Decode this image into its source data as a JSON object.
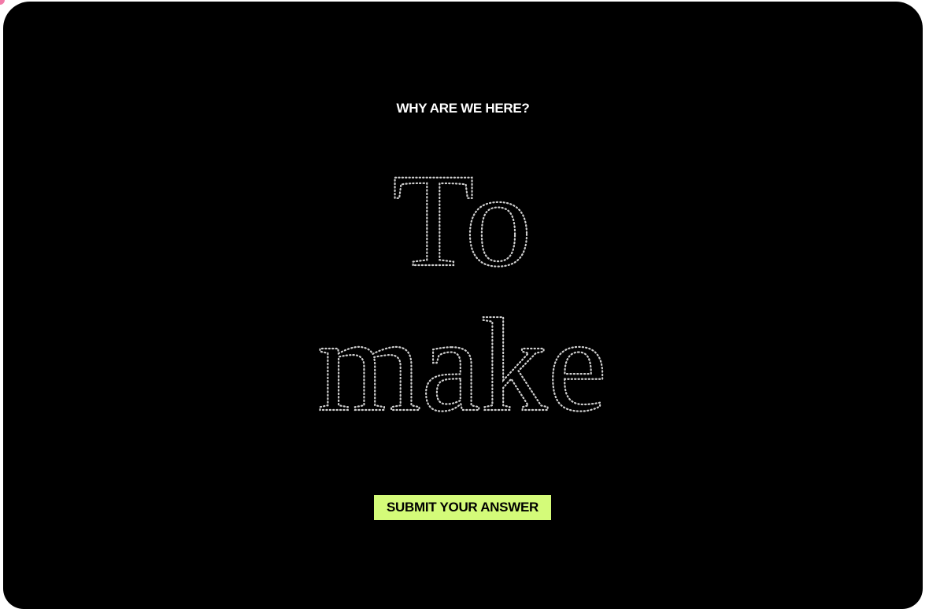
{
  "hero": {
    "question": "WHY ARE WE HERE?",
    "answer_line_1": "To",
    "answer_line_2": "make"
  },
  "actions": {
    "submit_label": "SUBMIT YOUR ANSWER"
  },
  "colors": {
    "background": "#000000",
    "accent": "#d4fb79",
    "text": "#ffffff",
    "dotted_letters": "#cfcfcf",
    "corner_accent": "#f27aa8"
  }
}
